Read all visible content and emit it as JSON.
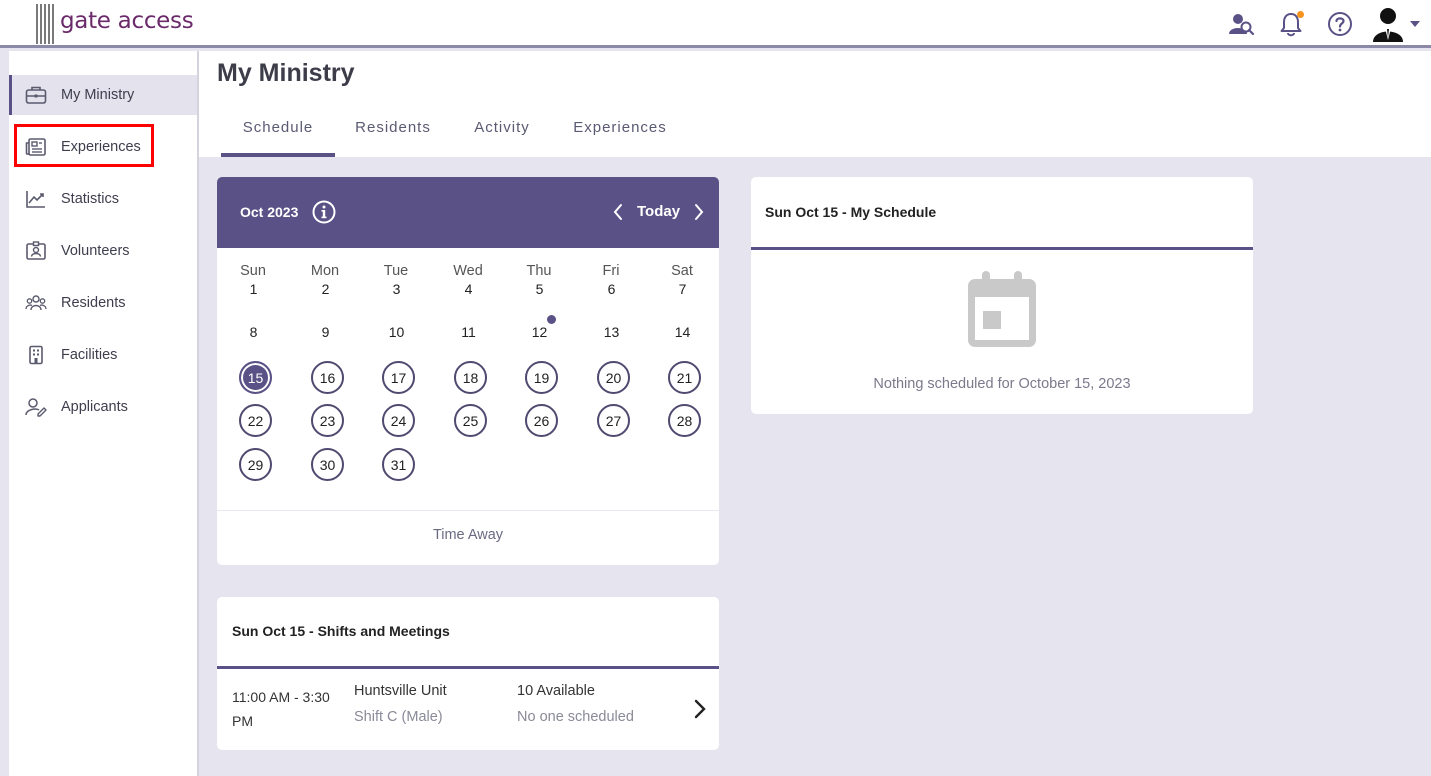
{
  "header": {
    "logo_text": "gate access",
    "icons": [
      "search-user-icon",
      "bell-icon",
      "help-icon",
      "avatar",
      "caret-down-icon"
    ],
    "accent_color": "#5a5286",
    "notification_dot_color": "#f7941d"
  },
  "sidebar": {
    "items": [
      {
        "label": "My Ministry",
        "icon": "briefcase-icon",
        "active": true
      },
      {
        "label": "Experiences",
        "icon": "newspaper-icon",
        "active": false
      },
      {
        "label": "Statistics",
        "icon": "trend-chart-icon",
        "active": false
      },
      {
        "label": "Volunteers",
        "icon": "badge-icon",
        "active": false
      },
      {
        "label": "Residents",
        "icon": "people-icon",
        "active": false
      },
      {
        "label": "Facilities",
        "icon": "building-icon",
        "active": false
      },
      {
        "label": "Applicants",
        "icon": "user-edit-icon",
        "active": false
      }
    ]
  },
  "page": {
    "title": "My Ministry",
    "tabs": [
      {
        "label": "Schedule",
        "active": true
      },
      {
        "label": "Residents",
        "active": false
      },
      {
        "label": "Activity",
        "active": false
      },
      {
        "label": "Experiences",
        "active": false
      }
    ]
  },
  "calendar": {
    "month_label": "Oct 2023",
    "today_label": "Today",
    "weekdays": [
      "Sun",
      "Mon",
      "Tue",
      "Wed",
      "Thu",
      "Fri",
      "Sat"
    ],
    "days": [
      "1",
      "2",
      "3",
      "4",
      "5",
      "6",
      "7",
      "8",
      "9",
      "10",
      "11",
      "12",
      "13",
      "14",
      "15",
      "16",
      "17",
      "18",
      "19",
      "20",
      "21",
      "22",
      "23",
      "24",
      "25",
      "26",
      "27",
      "28",
      "29",
      "30",
      "31"
    ],
    "selected_day": "15",
    "event_dot_day": "12",
    "time_away_label": "Time Away"
  },
  "schedule": {
    "title": "Sun Oct 15 - My Schedule",
    "empty_text": "Nothing scheduled for October 15, 2023"
  },
  "shifts": {
    "title": "Sun Oct 15 - Shifts and Meetings",
    "rows": [
      {
        "time": "11:00 AM - 3:30 PM",
        "unit": "Huntsville Unit",
        "shift": "Shift C (Male)",
        "available": "10 Available",
        "status": "No one scheduled"
      }
    ]
  }
}
